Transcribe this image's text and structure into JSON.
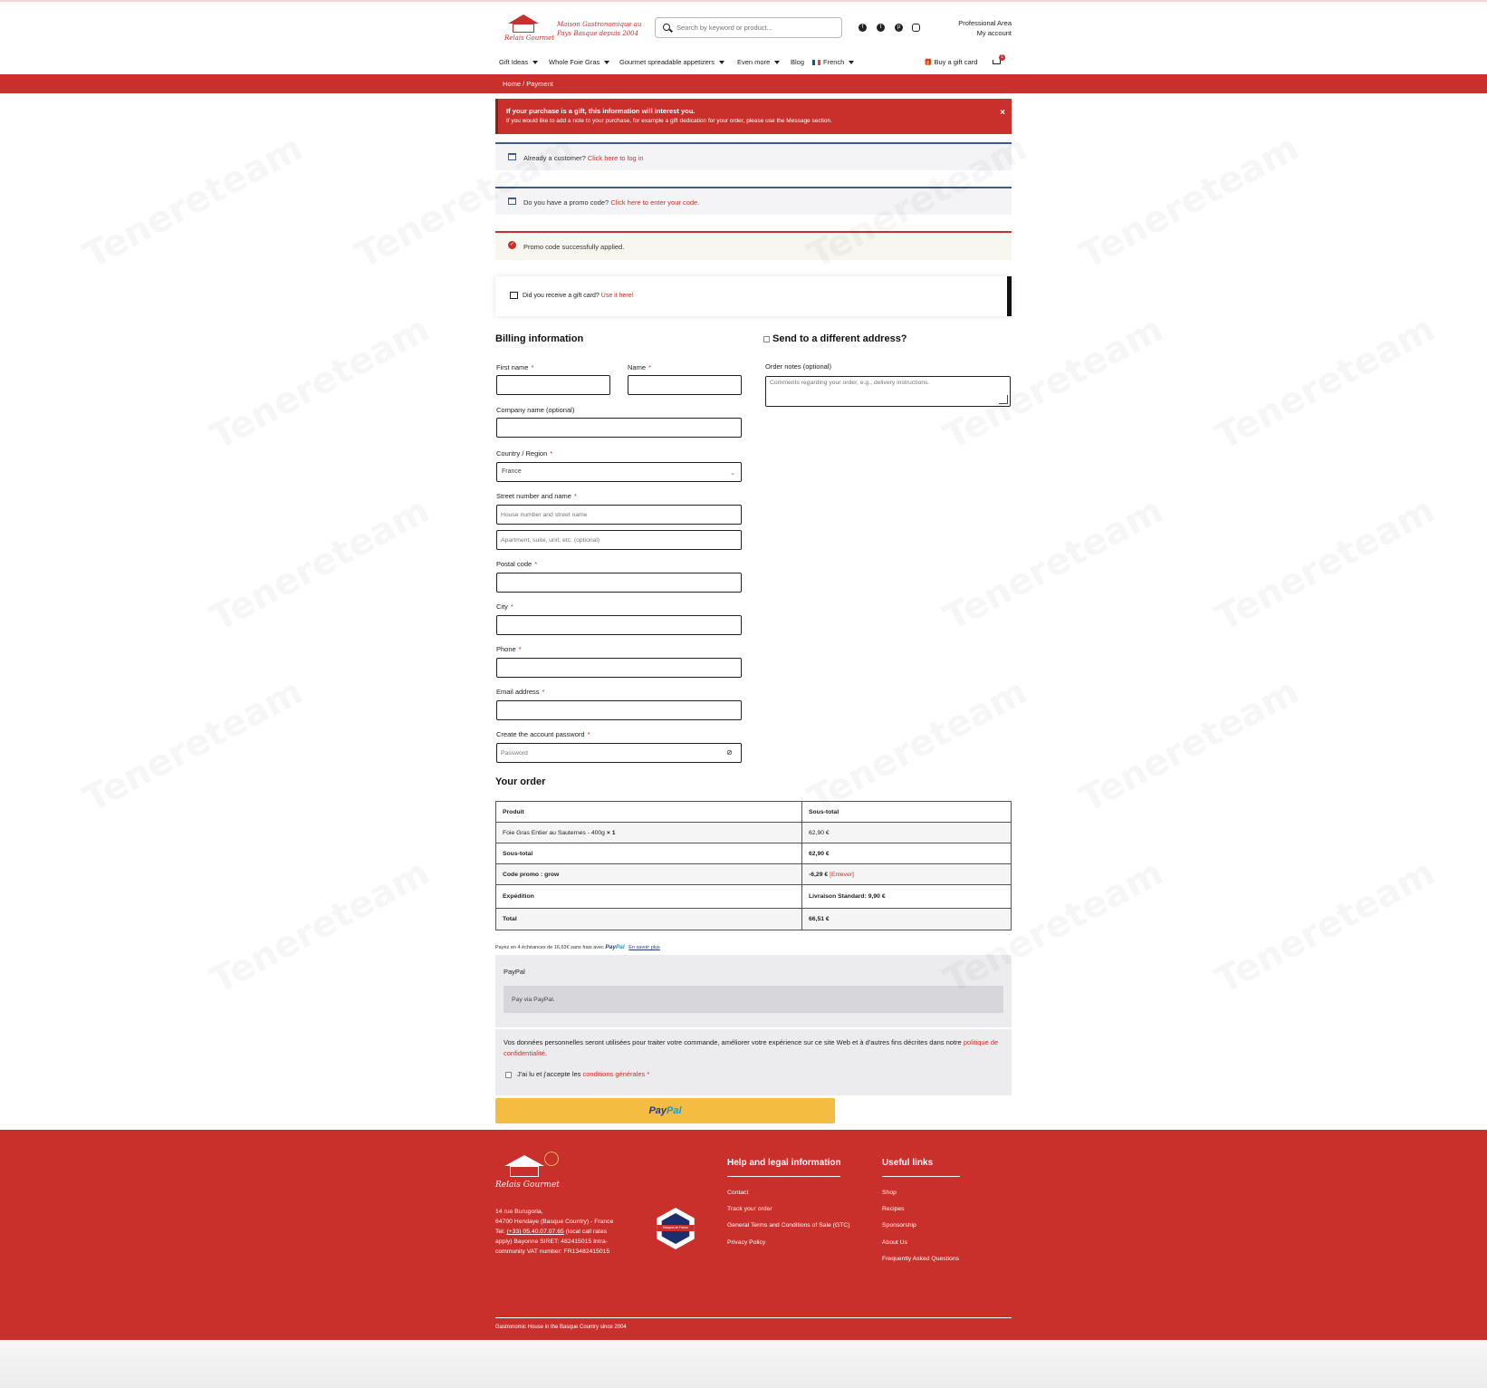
{
  "header": {
    "logo_tagline": "Maison Gastronomique au Pays Basque depuis 2004",
    "logo_brand": "Relais Gourmet",
    "search_placeholder": "Search by keyword or product...",
    "social_icons": [
      "facebook-icon",
      "twitter-icon",
      "pinterest-icon",
      "instagram-icon"
    ],
    "professional_area": "Professional Area",
    "my_account": "My account",
    "nav": [
      {
        "label": "Gift Ideas",
        "dropdown": true
      },
      {
        "label": "Whole Foie Gras",
        "dropdown": true
      },
      {
        "label": "Gourmet spreadable appetizers",
        "dropdown": true
      },
      {
        "label": "Even more",
        "dropdown": true
      },
      {
        "label": "Blog",
        "dropdown": false
      },
      {
        "label": "French",
        "dropdown": true
      }
    ],
    "buy_gift_card": "Buy a gift card",
    "cart_count": "1"
  },
  "breadcrumb": "Home  /  Payment",
  "gift_notice": {
    "title": "If your purchase is a gift, this information will interest you.",
    "text": "If you would like to add a note to your purchase, for example a gift dedication for your order, please use the Message section.",
    "close": "×"
  },
  "login_notice": {
    "text": "Already a customer?",
    "link": "Click here to log in"
  },
  "promo_notice": {
    "text": "Do you have a promo code?",
    "link": "Click here to enter your code."
  },
  "promo_success": "Promo code successfully applied.",
  "gift_card": {
    "text": "Did you receive a gift card?",
    "link": "Use it here!"
  },
  "billing": {
    "title": "Billing information",
    "first_name": "First name",
    "name": "Name",
    "company": "Company name",
    "company_optional": "(optional)",
    "country_label": "Country / Region",
    "country_value": "France",
    "street_label": "Street number and name",
    "street_placeholder": "House number and street name",
    "apt_placeholder": "Apartment, suite, unit, etc. (optional)",
    "postal": "Postal code",
    "city": "City",
    "phone": "Phone",
    "email": "Email address",
    "password_label": "Create the account password",
    "password_placeholder": "Password",
    "req": "*"
  },
  "shipping": {
    "title": "Send to a different address?",
    "notes_label": "Order notes",
    "notes_optional": "(optional)",
    "notes_placeholder": "Comments regarding your order, e.g., delivery instructions."
  },
  "order": {
    "title": "Your order",
    "col_product": "Produit",
    "col_subtotal": "Sous-total",
    "item_name": "Foie Gras Entier au Sauternes - 400g",
    "item_qty": "× 1",
    "item_price": "62,90 €",
    "subtotal_label": "Sous-total",
    "subtotal_value": "62,90 €",
    "promo_label": "Code promo : grow",
    "promo_value": "-6,29 €",
    "promo_remove": "[Enlever]",
    "shipping_label": "Expédition",
    "shipping_value": "Livraison Standard: 9,90 €",
    "total_label": "Total",
    "total_value": "66,51 €"
  },
  "paypal": {
    "installments": "Payez en 4 échéances de 16,63€ sans frais avec",
    "brand_pay": "Pay",
    "brand_pal": "Pal",
    "learn_more": "En savoir plus",
    "method_title": "PayPal",
    "method_desc": "Pay via PayPal.",
    "privacy_text": "Vos données personnelles seront utilisées pour traiter votre commande, améliorer votre expérience sur ce site Web et à d'autres fins décrites dans notre",
    "privacy_link": "politique de confidentialité",
    "privacy_end": ".",
    "terms_text": "J'ai lu et j'accepte les",
    "terms_link": "conditions générales",
    "terms_req": "*"
  },
  "footer": {
    "brand": "Relais Gourmet",
    "address_1": "14 rue Burugoria,",
    "address_2": "64700 Hendaye (Basque Country) - France",
    "tel_label": "Tel:",
    "tel": "(+33) 05.40.07.07.65",
    "tel_rest": "(local call rates apply) Bayonne SIRET: 482415015 Intra-community VAT number: FR13482415015",
    "badge_text": "Marques de France",
    "help_title": "Help and legal information",
    "help_links": [
      "Contact",
      "Track your order",
      "General Terms and Conditions of Sale (GTC)",
      "Privacy Policy"
    ],
    "useful_title": "Useful links",
    "useful_links": [
      "Shop",
      "Recipes",
      "Sponsorship",
      "About Us",
      "Frequently Asked Questions"
    ],
    "copyright": "Gastronomic House in the Basque Country since 2004"
  },
  "watermark": "Tenereteam",
  "colors": {
    "brand_red": "#c9302c",
    "paypal_yellow": "#f4bc41",
    "info_blue": "#3a5d8a"
  }
}
